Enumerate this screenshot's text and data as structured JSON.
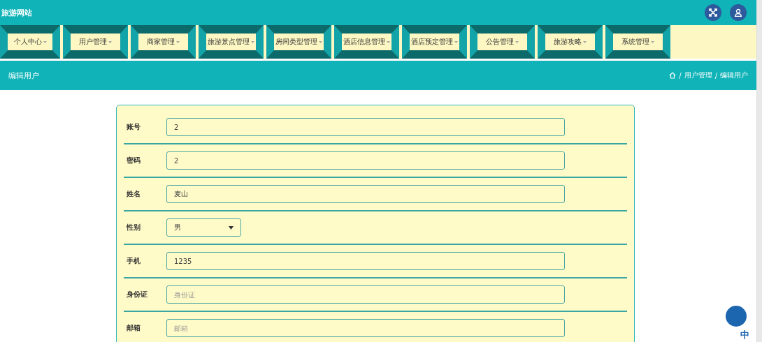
{
  "header": {
    "title": "旅游网站"
  },
  "nav": [
    {
      "label": "个人中心"
    },
    {
      "label": "用户管理"
    },
    {
      "label": "商家管理"
    },
    {
      "label": "旅游景点管理"
    },
    {
      "label": "房间类型管理"
    },
    {
      "label": "酒店信息管理"
    },
    {
      "label": "酒店预定管理"
    },
    {
      "label": "公告管理"
    },
    {
      "label": "旅游攻略"
    },
    {
      "label": "系统管理"
    }
  ],
  "page_title": "编辑用户",
  "breadcrumb": [
    {
      "separator": "/",
      "label": "用户管理"
    },
    {
      "separator": "/",
      "label": "编辑用户"
    }
  ],
  "form": [
    {
      "kind": "input",
      "label": "账号",
      "value": "2"
    },
    {
      "kind": "input",
      "label": "密码",
      "value": "2"
    },
    {
      "kind": "input",
      "label": "姓名",
      "value": "麦山"
    },
    {
      "kind": "select",
      "label": "性别",
      "value": "男"
    },
    {
      "kind": "input",
      "label": "手机",
      "value": "1235"
    },
    {
      "kind": "input",
      "label": "身份证",
      "placeholder": "身份证"
    },
    {
      "kind": "input",
      "label": "邮箱",
      "placeholder": "邮箱"
    }
  ],
  "ime_toolbar": {
    "mode": "中"
  }
}
